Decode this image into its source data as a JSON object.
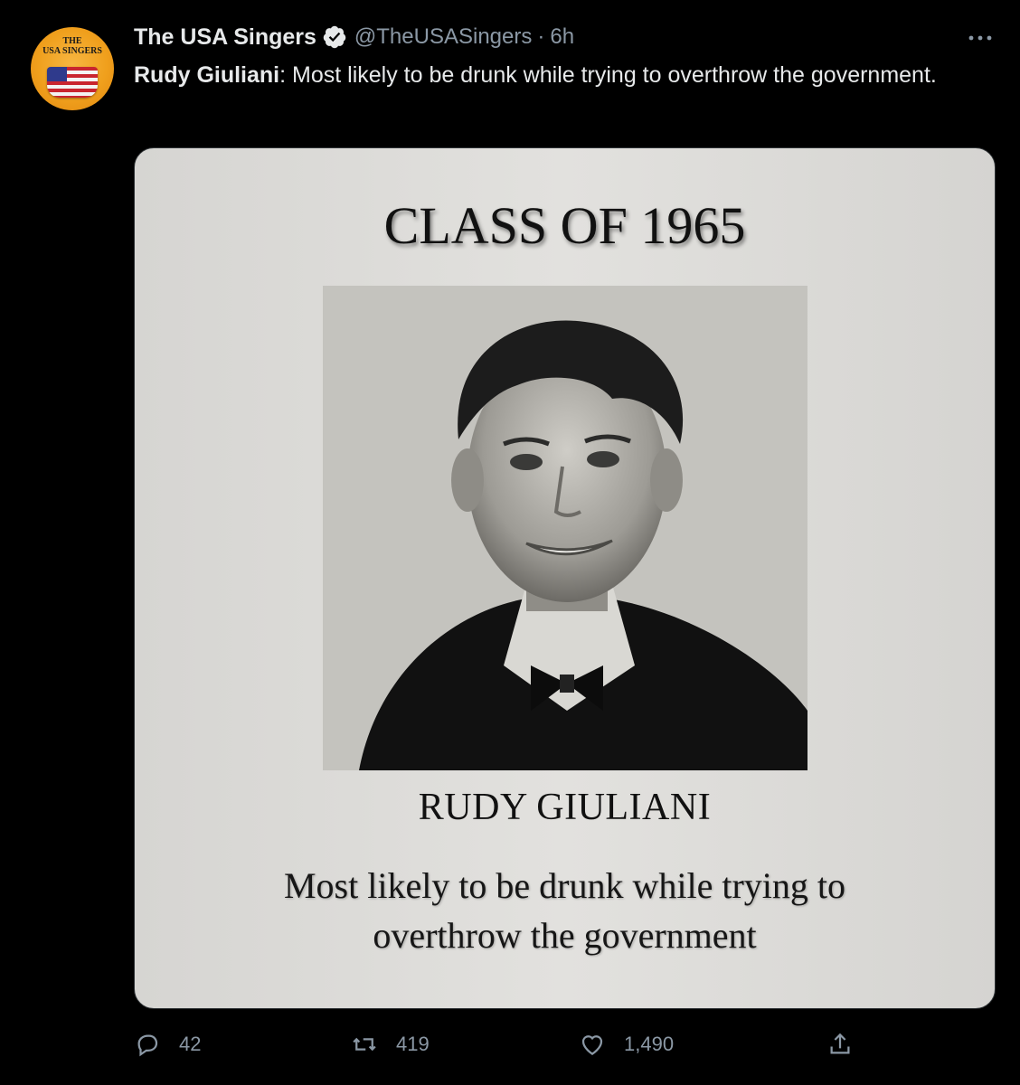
{
  "tweet": {
    "author_name": "The USA Singers",
    "handle": "@TheUSASingers",
    "separator": "·",
    "time": "6h",
    "text_bold": "Rudy Giuliani",
    "text_rest": ": Most likely to be drunk while trying to overthrow the government."
  },
  "avatar": {
    "text_line1": "THE",
    "text_line2": "USA SINGERS"
  },
  "card": {
    "class_title": "CLASS OF 1965",
    "person_name": "RUDY GIULIANI",
    "caption": "Most likely to be drunk while trying to overthrow the government"
  },
  "actions": {
    "replies": "42",
    "retweets": "419",
    "likes": "1,490"
  },
  "icons": [
    "verified-icon",
    "more-icon",
    "reply-icon",
    "retweet-icon",
    "like-icon",
    "share-icon"
  ]
}
